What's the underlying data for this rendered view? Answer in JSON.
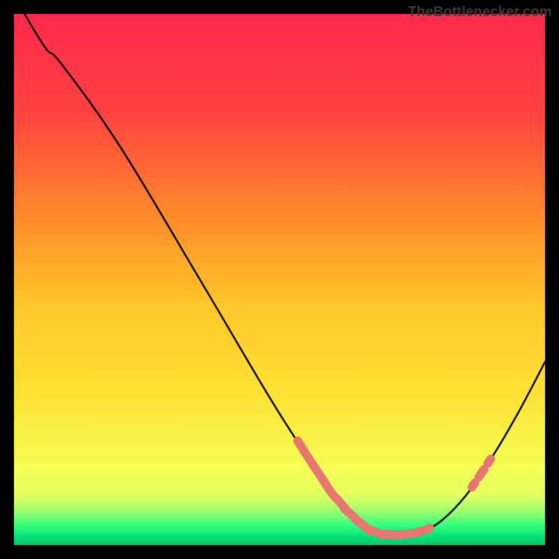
{
  "watermark": "TheBottlenecker.com",
  "chart_data": {
    "type": "line",
    "title": "",
    "xlabel": "",
    "ylabel": "",
    "xlim": [
      0,
      100
    ],
    "ylim": [
      0,
      100
    ],
    "grid": false,
    "legend": false,
    "gradient": {
      "top": "#ff2a4d",
      "upper_mid": "#ff6a2a",
      "mid": "#ffe234",
      "low_band_top": "#f5ff66",
      "low_band_bottom": "#00e07a",
      "bottom_line": "#00c86e"
    },
    "curve": {
      "comment": "x = 0..100 (percent of plot width), y = 0..100 (0=top, 100=bottom); visual V-shape",
      "points": [
        {
          "x": 2.0,
          "y": 0.0
        },
        {
          "x": 6.0,
          "y": 6.5
        },
        {
          "x": 9.0,
          "y": 9.5
        },
        {
          "x": 20.0,
          "y": 25.0
        },
        {
          "x": 35.0,
          "y": 50.0
        },
        {
          "x": 48.0,
          "y": 72.0
        },
        {
          "x": 55.0,
          "y": 83.0
        },
        {
          "x": 60.0,
          "y": 90.5
        },
        {
          "x": 63.0,
          "y": 94.0
        },
        {
          "x": 66.0,
          "y": 96.6
        },
        {
          "x": 69.0,
          "y": 97.8
        },
        {
          "x": 72.0,
          "y": 98.0
        },
        {
          "x": 76.0,
          "y": 97.6
        },
        {
          "x": 80.0,
          "y": 95.8
        },
        {
          "x": 85.0,
          "y": 90.8
        },
        {
          "x": 90.0,
          "y": 83.5
        },
        {
          "x": 95.0,
          "y": 75.0
        },
        {
          "x": 100.0,
          "y": 65.5
        }
      ]
    },
    "markers": {
      "comment": "salmon rounded dots/dashes along the curve near the valley",
      "color": "#e6766f",
      "items": [
        {
          "x": 54.0,
          "y": 81.3,
          "len": 2.2
        },
        {
          "x": 55.2,
          "y": 83.2,
          "len": 2.2
        },
        {
          "x": 56.5,
          "y": 85.2,
          "len": 1.0
        },
        {
          "x": 57.7,
          "y": 87.0,
          "len": 2.8
        },
        {
          "x": 59.0,
          "y": 89.0,
          "len": 2.8
        },
        {
          "x": 60.3,
          "y": 90.8,
          "len": 1.0
        },
        {
          "x": 61.6,
          "y": 92.2,
          "len": 2.6
        },
        {
          "x": 63.2,
          "y": 94.0,
          "len": 2.6
        },
        {
          "x": 64.5,
          "y": 95.3,
          "len": 1.0
        },
        {
          "x": 66.0,
          "y": 96.5,
          "len": 2.6
        },
        {
          "x": 68.0,
          "y": 97.5,
          "len": 3.2
        },
        {
          "x": 71.0,
          "y": 98.0,
          "len": 3.6
        },
        {
          "x": 74.0,
          "y": 97.9,
          "len": 3.0
        },
        {
          "x": 76.2,
          "y": 97.5,
          "len": 1.0
        },
        {
          "x": 77.8,
          "y": 97.0,
          "len": 1.0
        },
        {
          "x": 86.5,
          "y": 88.7,
          "len": 1.0
        },
        {
          "x": 88.0,
          "y": 86.5,
          "len": 1.8
        },
        {
          "x": 89.5,
          "y": 84.2,
          "len": 1.0
        }
      ]
    }
  }
}
